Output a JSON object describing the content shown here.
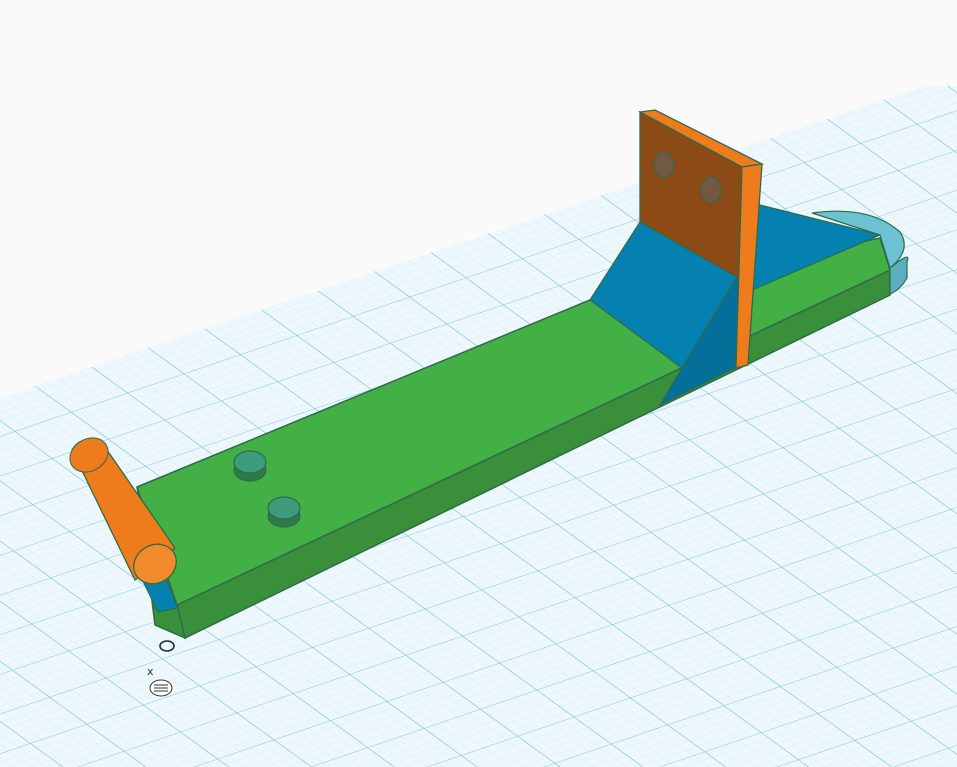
{
  "scene": {
    "background_color": "#fafafa",
    "grid": {
      "fine_color": "#bfe6f2",
      "major_color": "#49b5d9",
      "fill_color": "#eef8fc"
    },
    "colors": {
      "base_top": "#42b045",
      "base_side": "#3a8f3b",
      "base_edge": "#2f6b4a",
      "wedge_blue": "#0581b1",
      "wedge_blue_dark": "#047099",
      "half_disc": "#6cc2d3",
      "orange": "#ef7c1c",
      "orange_dark": "#8c4a16",
      "hole_fill": "#3c9c7c"
    },
    "origin_marker": {
      "axis_label": "x",
      "icon": "grid-snap-icon"
    }
  }
}
